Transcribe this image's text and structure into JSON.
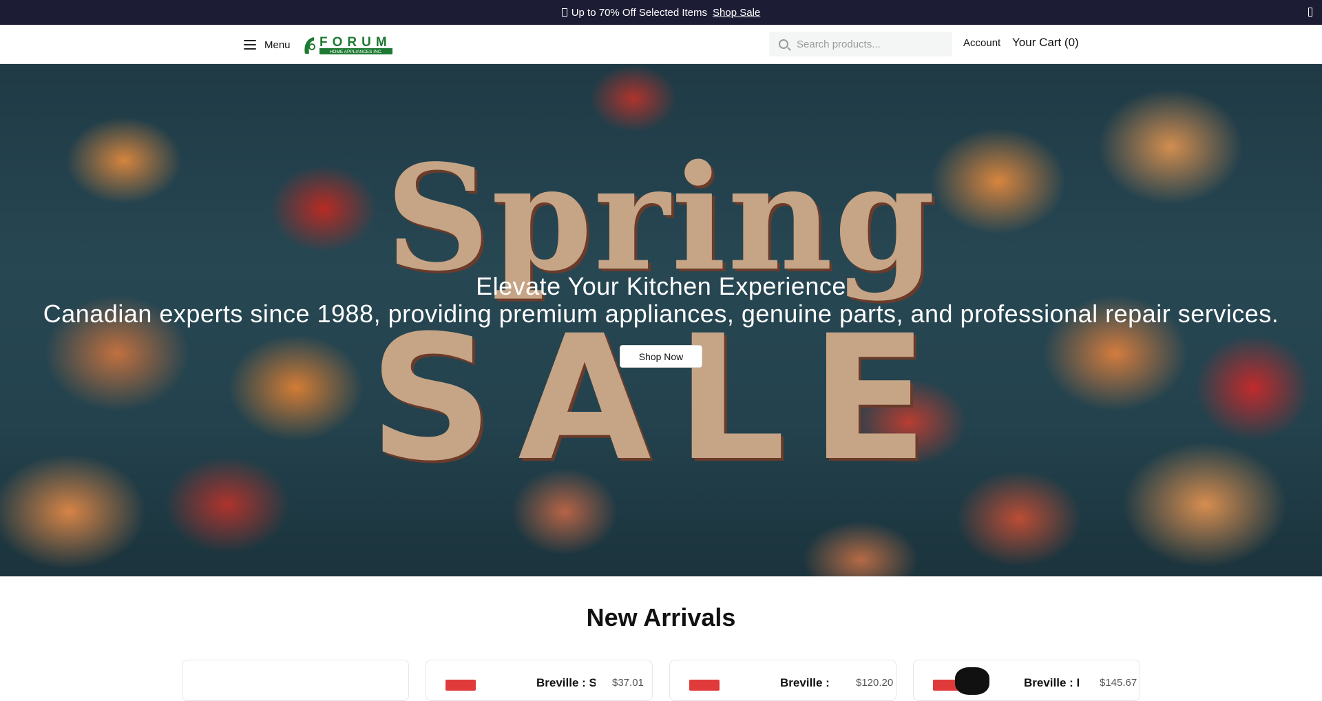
{
  "announcement": {
    "message": "Up to 70% Off Selected Items",
    "link_label": "Shop Sale"
  },
  "header": {
    "menu_label": "Menu",
    "logo_text": "FORUM",
    "logo_subtext": "HOME APPLIANCES INC.",
    "search_placeholder": "Search products...",
    "account_label": "Account",
    "cart_label": "Your Cart (0)"
  },
  "hero": {
    "image_words": [
      "Spring",
      "SALE"
    ],
    "title": "Elevate Your Kitchen Experience",
    "subtitle": "Canadian experts since 1988, providing premium appliances, genuine parts, and professional repair services.",
    "button_label": "Shop Now"
  },
  "new_arrivals": {
    "title": "New Arrivals",
    "products": [
      {
        "name": "",
        "price": ""
      },
      {
        "name": "Breville : S",
        "price": "$37.01"
      },
      {
        "name": "Breville : ",
        "price": "$120.20"
      },
      {
        "name": "Breville : I",
        "price": "$145.67"
      }
    ]
  },
  "colors": {
    "announcement_bg": "#1c1c35",
    "logo_green": "#1e7a32",
    "badge_red": "#e03a3a"
  }
}
